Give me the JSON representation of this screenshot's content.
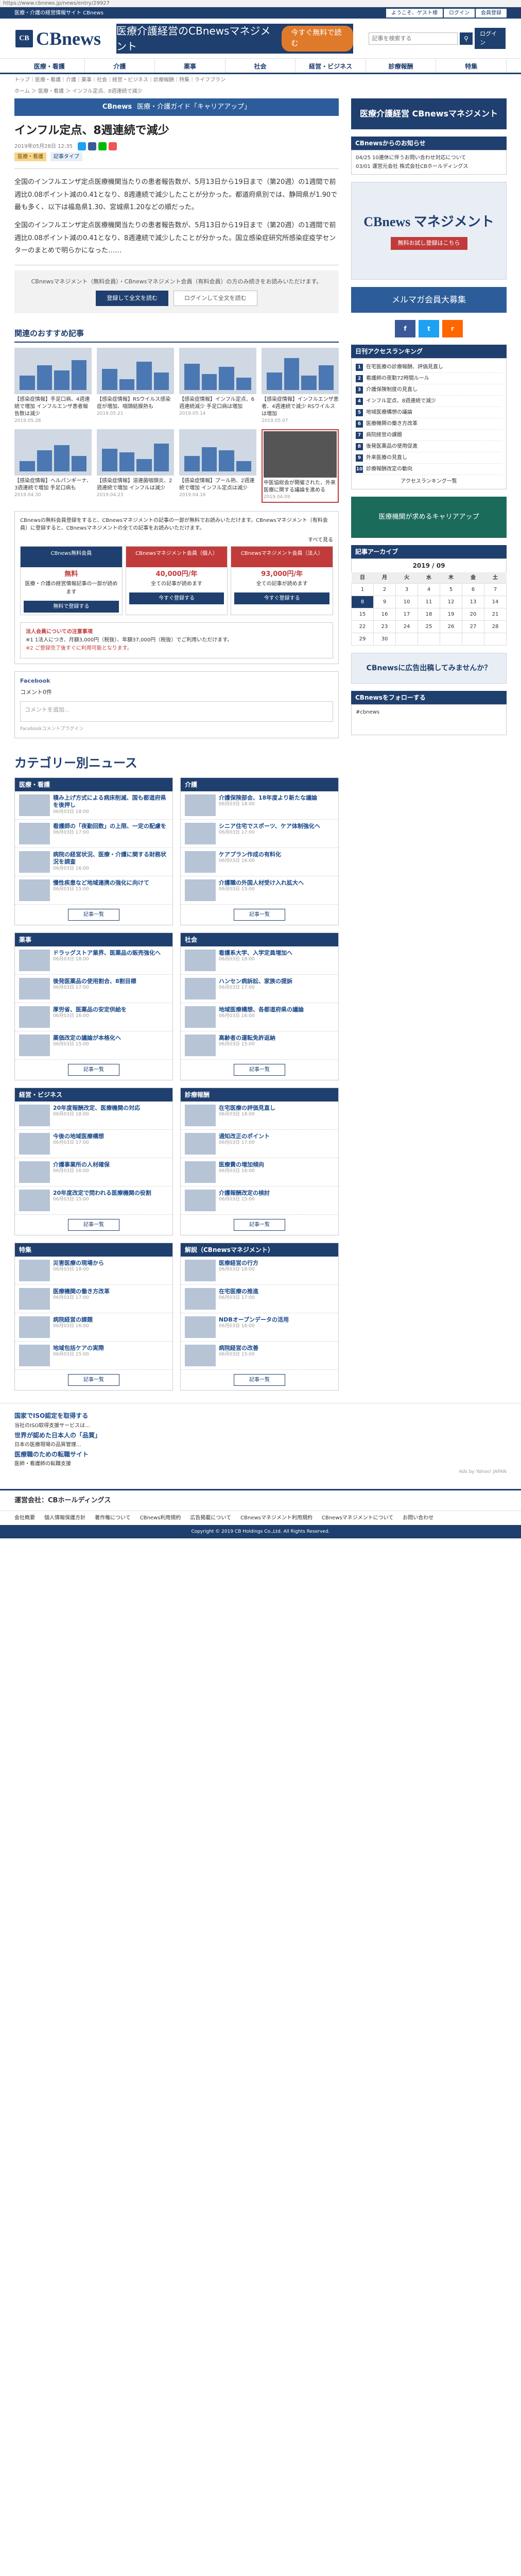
{
  "browser": {
    "url": "https://www.cbnews.jp/news/entry/29927"
  },
  "topstrip": {
    "left": "医療・介護の経営情報サイト CBnews",
    "links": [
      "ようこそ、ゲスト様",
      "ログイン",
      "会員登録"
    ]
  },
  "header": {
    "logo": "CBnews",
    "banner_title": "医療介護経営のCBnewsマネジメント",
    "banner_pill": "今すぐ無料で読む",
    "search_placeholder": "記事を検索する",
    "login": "ログイン"
  },
  "nav": [
    "医療・看護",
    "介護",
    "薬事",
    "社会",
    "経営・ビジネス",
    "診療報酬",
    "特集"
  ],
  "subnav": "トップ｜医療・看護｜介護｜薬事｜社会｜経営・ビジネス｜診療報酬｜特集｜ライフプラン",
  "crumbs": "ホーム ＞ 医療・看護 ＞ インフル定点、8週連続で減少",
  "promo_banner": {
    "brand": "CBnews",
    "text": "医療・介護ガイド「キャリアアップ」"
  },
  "article": {
    "title": "インフル定点、8週連続で減少",
    "date": "2019年05月28日 12:35",
    "tags": [
      "医療・看護",
      "記事タイプ"
    ],
    "p1": "全国のインフルエンザ定点医療機関当たりの患者報告数が、5月13日から19日まで（第20週）の1週間で前週比0.08ポイント減の0.41となり、8週連続で減少したことが分かった。都道府県別では、静岡県が1.90で最も多く、以下は福島県1.30、宮城県1.20などの順だった。",
    "p2": "全国のインフルエンザ定点医療機関当たりの患者報告数が、5月13日から19日まで（第20週）の1週間で前週比0.08ポイント減の0.41となり、8週連続で減少したことが分かった。国立感染症研究所感染症疫学センターのまとめで明らかになった……",
    "paywall_text": "CBnewsマネジメント（無料会員）・CBnewsマネジメント会員（有料会員）の方のみ続きをお読みいただけます。",
    "register": "登録して全文を読む",
    "login": "ログインして全文を読む"
  },
  "recommend": {
    "title": "関連のおすすめ記事",
    "items": [
      {
        "title": "【感染症情報】手足口病、4週連続で増加 インフルエンザ患者報告数は減少",
        "date": "2019.05.28"
      },
      {
        "title": "【感染症情報】RSウイルス感染症が増加、咽頭結膜熱も",
        "date": "2019.05.21"
      },
      {
        "title": "【感染症情報】インフル定点、6週連続減少 手足口病は増加",
        "date": "2019.05.14"
      },
      {
        "title": "【感染症情報】インフルエンザ患者、4週連続で減少 RSウイルスは増加",
        "date": "2019.05.07"
      },
      {
        "title": "【感染症情報】ヘルパンギーナ、3週連続で増加 手足口病も",
        "date": "2019.04.30"
      },
      {
        "title": "【感染症情報】溶連菌咽頭炎、2週連続で増加 インフルは減少",
        "date": "2019.04.23"
      },
      {
        "title": "【感染症情報】プール熱、2週連続で増加 インフル定点は減少",
        "date": "2019.04.16"
      },
      {
        "title": "中医協総会が開催された、外来医療に関する議論を進める",
        "date": "2019.04.09"
      }
    ]
  },
  "plans": {
    "intro": "CBnewsの無料会員登録をすると、CBnewsマネジメントの記事の一部が無料でお読みいただけます。CBnewsマネジメント（有料会員）に登録すると、CBnewsマネジメントの全ての記事をお読みいただけます。",
    "cols": [
      {
        "name": "CBnews無料会員",
        "price": "無料",
        "features": "医療・介護の経営情報記事の一部が読めます",
        "btn": "無料で登録する"
      },
      {
        "name": "CBnewsマネジメント会員（個人）",
        "price": "40,000円/年",
        "features": "全ての記事が読めます",
        "btn": "今すぐ登録する"
      },
      {
        "name": "CBnewsマネジメント会員（法人）",
        "price": "93,000円/年",
        "features": "全ての記事が読めます",
        "btn": "今すぐ登録する"
      }
    ],
    "more": "すべて見る"
  },
  "notice": {
    "title": "法人会員についての注意事項",
    "text": "※1 1法人につき、月額3,000円（税抜）、年額37,000円（税抜）でご利用いただけます。",
    "warn": "※2 ご登録完了後すぐに利用可能となります。"
  },
  "facebook": {
    "label": "Facebook",
    "comments": "コメント0件",
    "placeholder": "コメントを追加...",
    "plugin": "Facebookコメントプラグイン"
  },
  "categories": {
    "title": "カテゴリー別ニュース",
    "more": "記事一覧",
    "boxes": [
      {
        "name": "医療・看護",
        "items": [
          {
            "title": "積み上げ方式による病床削減、国も都道府県を後押し",
            "date": "06月03日 18:00"
          },
          {
            "title": "看護師の「夜勤回数」の上限、一定の配慮を",
            "date": "06月03日 17:00"
          },
          {
            "title": "病院の経営状況、医療・介護に関する財務状況を調査",
            "date": "06月03日 16:00"
          },
          {
            "title": "慢性疾患など地域連携の強化に向けて",
            "date": "06月03日 15:00"
          }
        ]
      },
      {
        "name": "介護",
        "items": [
          {
            "title": "介護保険部会、18年度より新たな議論",
            "date": "06月03日 18:00"
          },
          {
            "title": "シニア住宅でスポーツ、ケア体制強化へ",
            "date": "06月03日 17:00"
          },
          {
            "title": "ケアプラン作成の有料化",
            "date": "06月03日 16:00"
          },
          {
            "title": "介護職の外国人材受け入れ拡大へ",
            "date": "06月03日 15:00"
          }
        ]
      },
      {
        "name": "薬事",
        "items": [
          {
            "title": "ドラッグストア業界、医薬品の販売強化へ",
            "date": "06月03日 18:00"
          },
          {
            "title": "後発医薬品の使用割合、8割目標",
            "date": "06月03日 17:00"
          },
          {
            "title": "厚労省、医薬品の安定供給を",
            "date": "06月03日 16:00"
          },
          {
            "title": "薬価改定の議論が本格化へ",
            "date": "06月03日 15:00"
          }
        ]
      },
      {
        "name": "社会",
        "items": [
          {
            "title": "看護系大学、入学定員増加へ",
            "date": "06月03日 18:00"
          },
          {
            "title": "ハンセン病訴訟、家族の提訴",
            "date": "06月03日 17:00"
          },
          {
            "title": "地域医療構想、各都道府県の議論",
            "date": "06月03日 16:00"
          },
          {
            "title": "高齢者の運転免許返納",
            "date": "06月03日 15:00"
          }
        ]
      },
      {
        "name": "経営・ビジネス",
        "items": [
          {
            "title": "20年度報酬改定、医療機関の対応",
            "date": "06月03日 18:00"
          },
          {
            "title": "今後の地域医療構想",
            "date": "06月03日 17:00"
          },
          {
            "title": "介護事業所の人材確保",
            "date": "06月03日 16:00"
          },
          {
            "title": "20年度改定で問われる医療機関の役割",
            "date": "06月03日 15:00"
          }
        ]
      },
      {
        "name": "診療報酬",
        "items": [
          {
            "title": "在宅医療の評価見直し",
            "date": "06月03日 18:00"
          },
          {
            "title": "通知改正のポイント",
            "date": "06月03日 17:00"
          },
          {
            "title": "医療費の増加傾向",
            "date": "06月03日 16:00"
          },
          {
            "title": "介護報酬改定の検討",
            "date": "06月03日 15:00"
          }
        ]
      },
      {
        "name": "特集",
        "items": [
          {
            "title": "災害医療の現場から",
            "date": "06月03日 18:00"
          },
          {
            "title": "医療機関の働き方改革",
            "date": "06月03日 17:00"
          },
          {
            "title": "病院経営の課題",
            "date": "06月03日 16:00"
          },
          {
            "title": "地域包括ケアの実際",
            "date": "06月03日 15:00"
          }
        ]
      },
      {
        "name": "解説（CBnewsマネジメント）",
        "items": [
          {
            "title": "医療経営の行方",
            "date": "06月03日 18:00"
          },
          {
            "title": "在宅医療の推進",
            "date": "06月03日 17:00"
          },
          {
            "title": "NDBオープンデータの活用",
            "date": "06月03日 16:00"
          },
          {
            "title": "病院経営の改善",
            "date": "06月03日 15:00"
          }
        ]
      }
    ]
  },
  "sidebar": {
    "mgmt_banner": "医療介護経営 CBnewsマネジメント",
    "notice_title": "CBnewsからのお知らせ",
    "notices": [
      "04/25 10連休に伴うお問い合わせ対応について",
      "03/01 運営元会社 株式会社CBホールディングス"
    ],
    "mgmt_ad_title": "CBnews マネジメント",
    "mgmt_ad_btn": "無料お試し登録はこちら",
    "mail_ad": "メルマガ会員大募集",
    "ranking_title": "日刊アクセスランキング",
    "ranking": [
      "在宅医療の診療報酬、評価見直し",
      "看護師の夜勤72時間ルール",
      "介護保険制度の見直し",
      "インフル定点、8週連続で減少",
      "地域医療構想の議論",
      "医療機関の働き方改革",
      "病院経営の課題",
      "後発医薬品の使用促進",
      "外来医療の見直し",
      "診療報酬改定の動向"
    ],
    "ranking_more": "アクセスランキング一覧",
    "career_ad": "医療機関が求めるキャリアアップ",
    "archive_title": "記事アーカイブ",
    "cal_month": "2019 / 09",
    "cal_head": [
      "日",
      "月",
      "火",
      "水",
      "木",
      "金",
      "土"
    ],
    "cal_rows": [
      [
        "1",
        "2",
        "3",
        "4",
        "5",
        "6",
        "7"
      ],
      [
        "8",
        "9",
        "10",
        "11",
        "12",
        "13",
        "14"
      ],
      [
        "15",
        "16",
        "17",
        "18",
        "19",
        "20",
        "21"
      ],
      [
        "22",
        "23",
        "24",
        "25",
        "26",
        "27",
        "28"
      ],
      [
        "29",
        "30",
        "",
        "",
        "",
        "",
        ""
      ]
    ],
    "ad_banner": "CBnewsに広告出稿してみませんか？",
    "twitter_title": "CBnewsをフォローする",
    "twitter_handle": "#cbnews"
  },
  "ads": {
    "label": "Ads by Yahoo! JAPAN",
    "items": [
      {
        "title": "国家でISO認定を取得する",
        "text": "当社のISO取得支援サービスは…"
      },
      {
        "title": "世界が認めた日本人の「品質」",
        "text": "日本の医療現場の品質管理…"
      },
      {
        "title": "医療職のための転職サイト",
        "text": "医師・看護師の転職支援"
      }
    ]
  },
  "footer": {
    "company": "運営会社：CBホールディングス",
    "links": [
      "会社概要",
      "個人情報保護方針",
      "著作権について",
      "CBnews利用規約",
      "広告掲載について",
      "CBnewsマネジメント利用規約",
      "CBnewsマネジメントについて",
      "お問い合わせ"
    ],
    "copyright": "Copyright © 2019 CB Holdings Co.,Ltd. All Rights Reserved."
  }
}
